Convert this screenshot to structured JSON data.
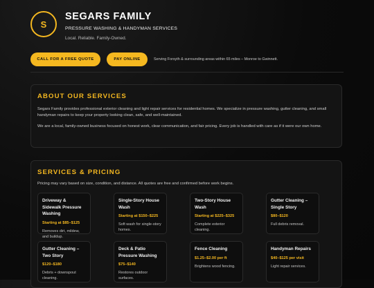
{
  "header": {
    "logo_letter": "S",
    "title": "SEGARS FAMILY",
    "subtitle": "PRESSURE WASHING & HANDYMAN SERVICES",
    "tagline": "Local. Reliable. Family-Owned."
  },
  "cta": {
    "quote_label": "CALL FOR A FREE QUOTE",
    "pay_label": "PAY ONLINE",
    "service_area": "Serving Forsyth & surrounding areas within 65 miles – Monroe to Gwinnett."
  },
  "about": {
    "title": "ABOUT OUR SERVICES",
    "paragraph_1": "Segars Family provides professional exterior cleaning and light repair services for residential homes. We specialize in pressure washing, gutter cleaning, and small handyman repairs to keep your property looking clean, safe, and well-maintained.",
    "paragraph_2": "We are a local, family-owned business focused on honest work, clear communication, and fair pricing. Every job is handled with care as if it were our own home."
  },
  "pricing": {
    "title": "SERVICES & PRICING",
    "note": "Pricing may vary based on size, condition, and distance. All quotes are free and confirmed before work begins.",
    "items": [
      {
        "name": "Driveway & Sidewalk Pressure Washing",
        "price": "Starting at $85–$125",
        "desc": "Removes dirt, mildew, and buildup."
      },
      {
        "name": "Single-Story House Wash",
        "price": "Starting at $150–$225",
        "desc": "Soft wash for single-story homes."
      },
      {
        "name": "Two-Story House Wash",
        "price": "Starting at $225–$325",
        "desc": "Complete exterior cleaning."
      },
      {
        "name": "Gutter Cleaning – Single Story",
        "price": "$80–$120",
        "desc": "Full debris removal."
      },
      {
        "name": "Gutter Cleaning – Two Story",
        "price": "$120–$180",
        "desc": "Debris + downspout cleaning."
      },
      {
        "name": "Deck & Patio Pressure Washing",
        "price": "$75–$140",
        "desc": "Restores outdoor surfaces."
      },
      {
        "name": "Fence Cleaning",
        "price": "$1.25–$2.00 per ft",
        "desc": "Brightens wood fencing."
      },
      {
        "name": "Handyman Repairs",
        "price": "$40–$125 per visit",
        "desc": "Light repair services."
      }
    ]
  },
  "colors": {
    "accent": "#f5b820",
    "background": "#0a0a0a",
    "card": "#141414"
  }
}
